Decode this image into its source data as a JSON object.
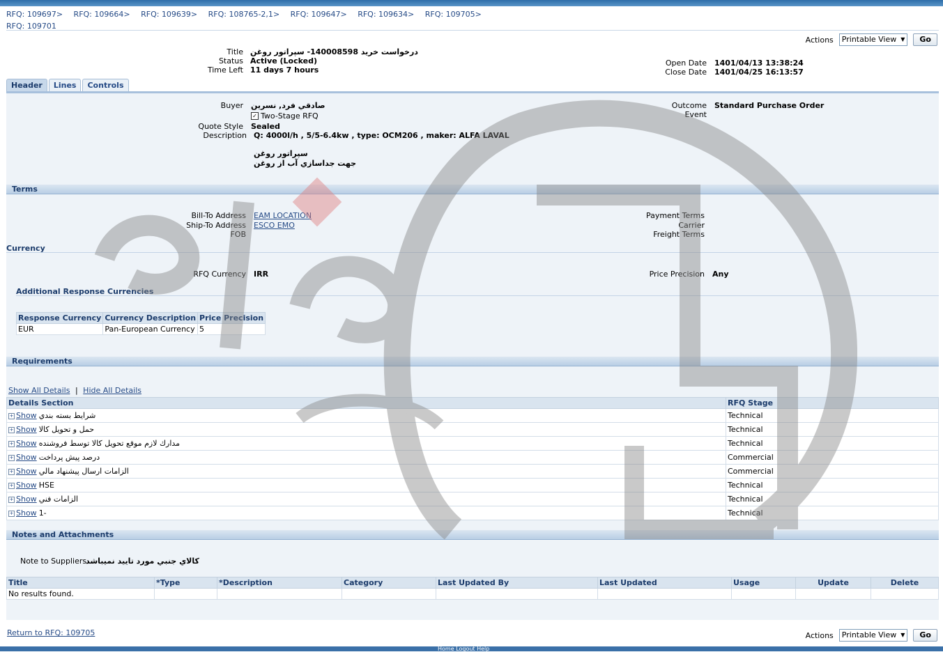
{
  "breadcrumbs": [
    "RFQ: 109697",
    "RFQ: 109664",
    "RFQ: 109639",
    "RFQ: 108765-2,1",
    "RFQ: 109647",
    "RFQ: 109634",
    "RFQ: 109705"
  ],
  "breadcrumb_separator": ">",
  "current_page": "RFQ: 109701",
  "actions": {
    "label": "Actions",
    "selected": "Printable View",
    "go_label": "Go"
  },
  "summary": {
    "title_label": "Title",
    "title_value": "درخواست خريد 140008598- سپراتور روغن",
    "status_label": "Status",
    "status_value": "Active (Locked)",
    "time_left_label": "Time Left",
    "time_left_value": "11 days 7 hours",
    "open_date_label": "Open Date",
    "open_date_value": "1401/04/13 13:38:24",
    "close_date_label": "Close Date",
    "close_date_value": "1401/04/25 16:13:57"
  },
  "tabs": [
    "Header",
    "Lines",
    "Controls"
  ],
  "header": {
    "buyer_label": "Buyer",
    "buyer_value": "صادقي فرد, نسرين",
    "two_stage_label": "Two-Stage RFQ",
    "quote_style_label": "Quote Style",
    "quote_style_value": "Sealed",
    "description_label": "Description",
    "description_line1": "Q: 4000l/h , 5/5-6.4kw , type: OCM206 , maker: ALFA LAVAL",
    "description_line2": "سپراتور روغن",
    "description_line3": "جهت جداسازي آب از روغن",
    "outcome_label": "Outcome",
    "outcome_value": "Standard Purchase Order",
    "event_label": "Event"
  },
  "terms": {
    "section_title": "Terms",
    "bill_to_label": "Bill-To Address",
    "bill_to_value": "EAM LOCATION",
    "ship_to_label": "Ship-To Address",
    "ship_to_value": "ESCO EMO",
    "fob_label": "FOB",
    "payment_terms_label": "Payment Terms",
    "carrier_label": "Carrier",
    "freight_terms_label": "Freight Terms"
  },
  "currency": {
    "section_title": "Currency",
    "rfq_currency_label": "RFQ Currency",
    "rfq_currency_value": "IRR",
    "price_precision_label": "Price Precision",
    "price_precision_value": "Any",
    "additional_title": "Additional Response Currencies",
    "table_headers": [
      "Response Currency",
      "Currency Description",
      "Price Precision"
    ],
    "rows": [
      [
        "EUR",
        "Pan-European Currency",
        "5"
      ]
    ]
  },
  "requirements": {
    "section_title": "Requirements",
    "show_all": "Show All Details",
    "hide_all": "Hide All Details",
    "col_details": "Details Section",
    "col_stage": "RFQ Stage",
    "show_label": "Show",
    "rows": [
      {
        "section": "شرايط بسته بندي",
        "stage": "Technical"
      },
      {
        "section": "حمل و تحويل كالا",
        "stage": "Technical"
      },
      {
        "section": "مدارك لازم موقع تحويل كالا توسط فروشنده",
        "stage": "Technical"
      },
      {
        "section": "درصد پيش پرداخت",
        "stage": "Commercial"
      },
      {
        "section": "الزامات ارسال پيشنهاد مالي",
        "stage": "Commercial"
      },
      {
        "section": "HSE",
        "stage": "Technical"
      },
      {
        "section": "الزامات فني",
        "stage": "Technical"
      },
      {
        "section": "1-",
        "stage": "Technical"
      }
    ]
  },
  "notes": {
    "section_title": "Notes and Attachments",
    "note_label": "Note to Suppliers",
    "note_value": "كالاي جنبي مورد تاييد نميباشد",
    "table_headers": [
      "Title",
      "*Type",
      "*Description",
      "Category",
      "Last Updated By",
      "Last Updated",
      "Usage",
      "Update",
      "Delete"
    ],
    "empty_text": "No results found."
  },
  "return_link": "Return to RFQ: 109705",
  "footer_links": "Home   Logout   Help",
  "colors": {
    "accent": "#254a86",
    "header_band": "#b8cee5",
    "panel": "#eef3f8"
  }
}
